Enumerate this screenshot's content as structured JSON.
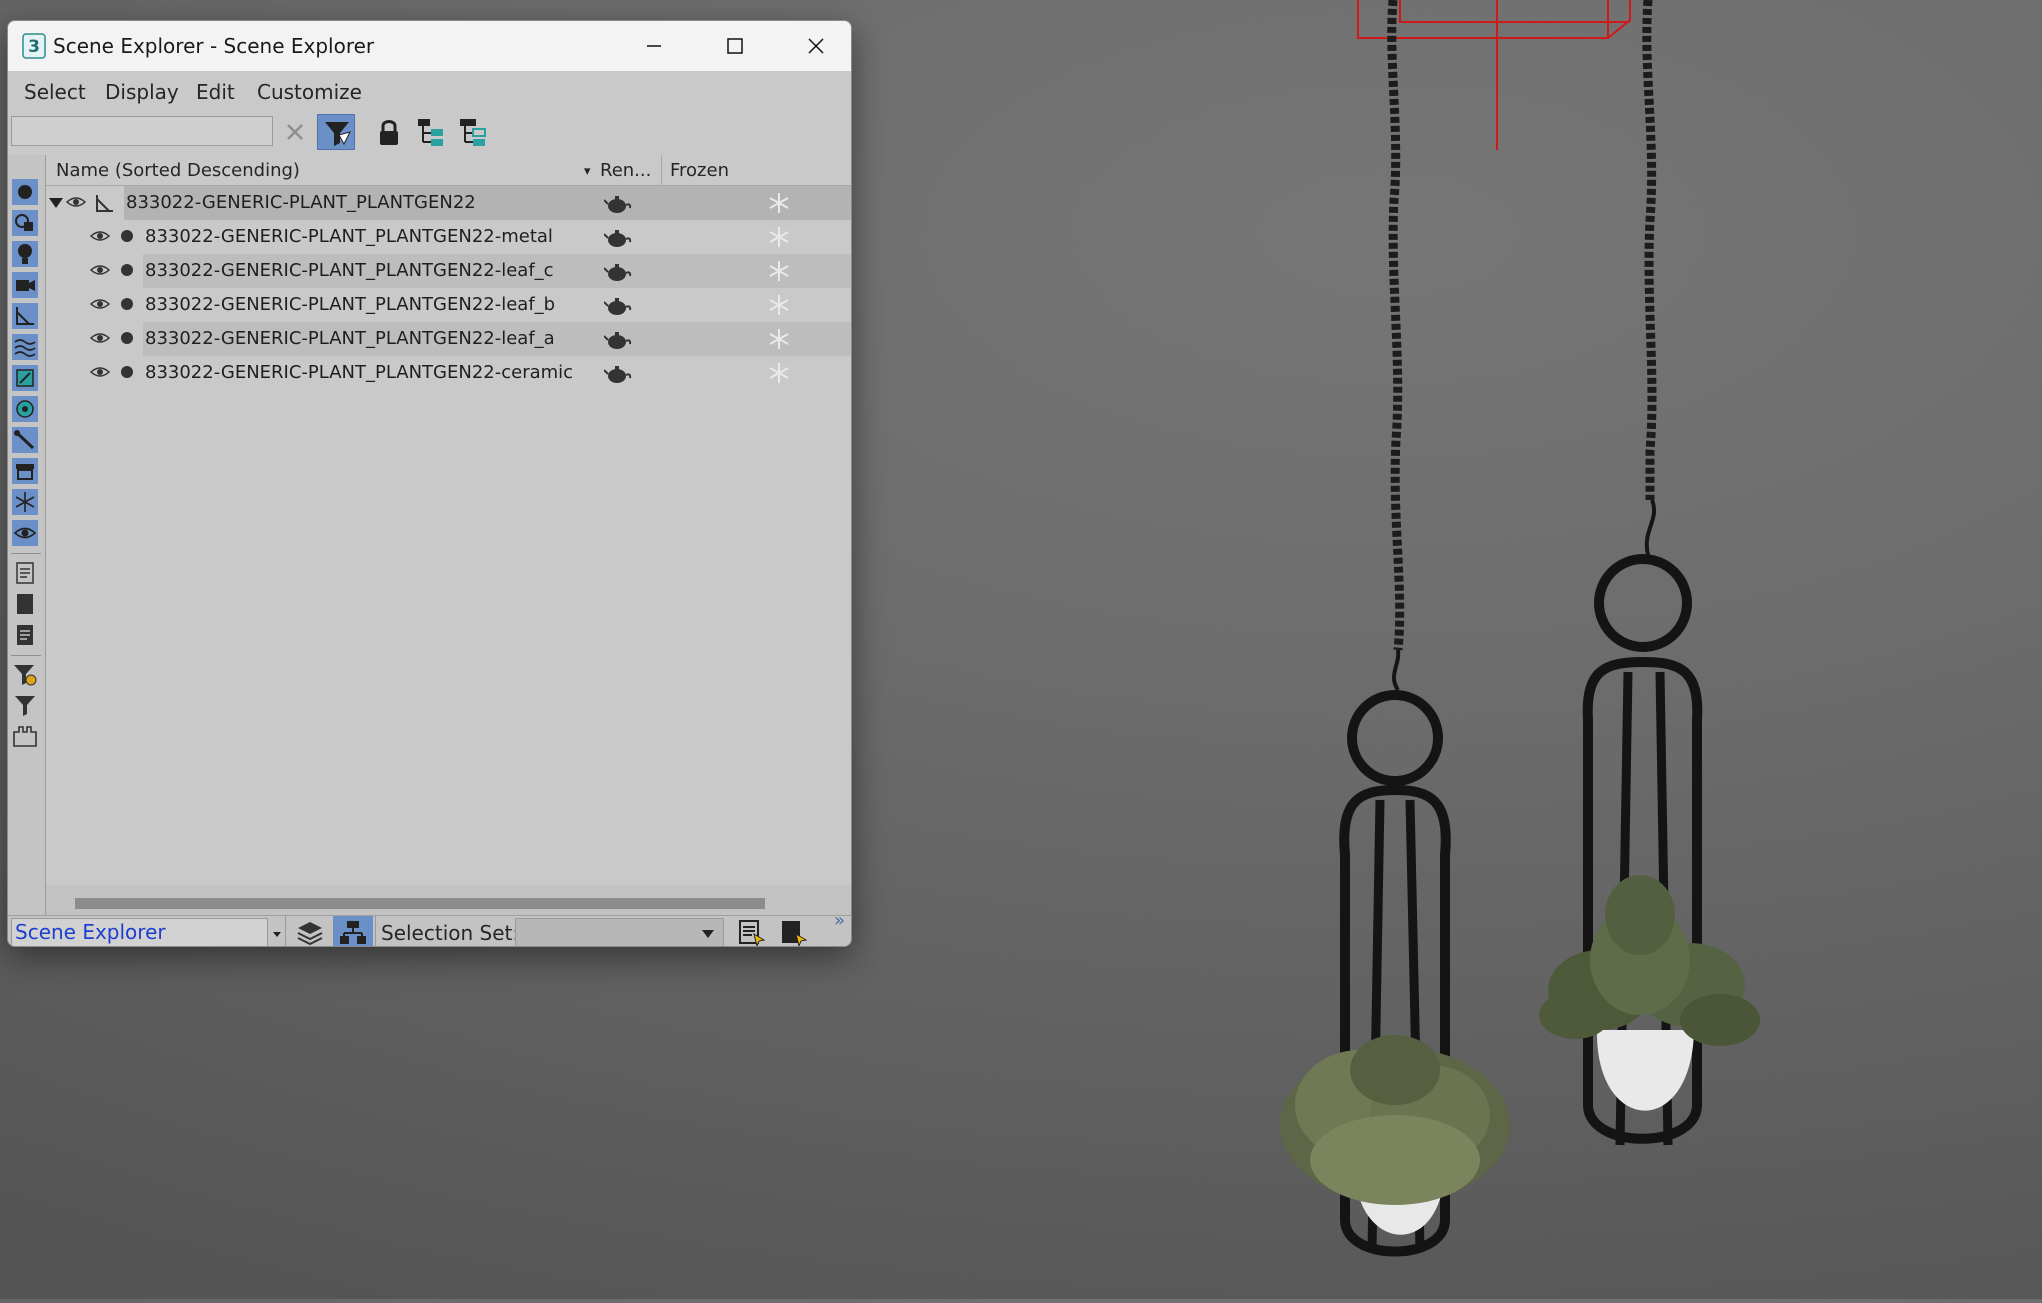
{
  "window": {
    "title": "Scene Explorer - Scene Explorer",
    "app_icon_glyph": "3"
  },
  "menu": [
    "Select",
    "Display",
    "Edit",
    "Customize"
  ],
  "search": {
    "value": "",
    "placeholder": ""
  },
  "columns": {
    "name": "Name (Sorted Descending)",
    "render": "Ren...",
    "frozen": "Frozen",
    "sort_indicator": "▾"
  },
  "rows": [
    {
      "name": "833022-GENERIC-PLANT_PLANTGEN22",
      "type": "group",
      "expanded": true,
      "selected": true
    },
    {
      "name": "833022-GENERIC-PLANT_PLANTGEN22-metal",
      "type": "object"
    },
    {
      "name": "833022-GENERIC-PLANT_PLANTGEN22-leaf_c",
      "type": "object"
    },
    {
      "name": "833022-GENERIC-PLANT_PLANTGEN22-leaf_b",
      "type": "object"
    },
    {
      "name": "833022-GENERIC-PLANT_PLANTGEN22-leaf_a",
      "type": "object"
    },
    {
      "name": "833022-GENERIC-PLANT_PLANTGEN22-ceramic",
      "type": "object"
    }
  ],
  "bottom": {
    "explorer_name": "Scene Explorer",
    "selection_set_label": "Selection Set:",
    "more_glyph": "»"
  },
  "colors": {
    "accent": "#6b8fc7",
    "explorer_link": "#1d3ecf",
    "annotation_arrow": "#e0393e",
    "selection_box": "#d01a1a"
  },
  "icons": {
    "left_toolbar": [
      "display-geometry-icon",
      "display-shapes-icon",
      "display-lights-icon",
      "display-cameras-icon",
      "display-helpers-icon",
      "display-spacewarps-icon",
      "display-groups-icon",
      "display-xrefs-icon",
      "display-bones-icon",
      "display-containers-icon",
      "display-frozen-icon",
      "display-hidden-icon",
      "display-all-icon",
      "display-none-icon",
      "invert-display-icon",
      "filter-settings-icon",
      "filter-icon",
      "container-icon"
    ]
  }
}
